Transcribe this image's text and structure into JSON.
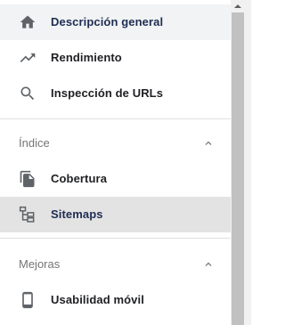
{
  "nav": {
    "items": [
      {
        "label": "Descripción general",
        "icon": "home-icon"
      },
      {
        "label": "Rendimiento",
        "icon": "trending-up-icon"
      },
      {
        "label": "Inspección de URLs",
        "icon": "search-icon"
      }
    ],
    "sections": [
      {
        "title": "Índice",
        "items": [
          {
            "label": "Cobertura",
            "icon": "copy-icon"
          },
          {
            "label": "Sitemaps",
            "icon": "sitemap-icon"
          }
        ]
      },
      {
        "title": "Mejoras",
        "items": [
          {
            "label": "Usabilidad móvil",
            "icon": "smartphone-icon"
          }
        ]
      }
    ]
  },
  "colors": {
    "active_text": "#1f2d52",
    "icon": "#5f6368",
    "selected_bg": "#e3e3e3",
    "hover_bg": "#f1f3f4",
    "section_title": "#757575"
  }
}
